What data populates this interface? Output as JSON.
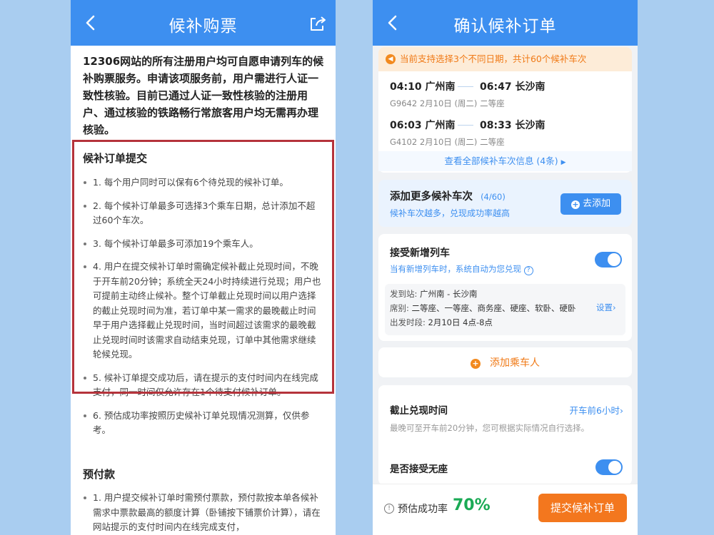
{
  "left": {
    "nav_title": "候补购票",
    "intro": "12306网站的所有注册用户均可自愿申请列车的候补购票服务。申请该项服务前，用户需进行人证一致性核验。目前已通过人证一致性核验的注册用户、通过核验的铁路畅行常旅客用户均无需再办理核验。",
    "section1_title": "候补订单提交",
    "rules": [
      "1. 每个用户同时可以保有6个待兑现的候补订单。",
      "2. 每个候补订单最多可选择3个乘车日期，总计添加不超过60个车次。",
      "3. 每个候补订单最多可添加19个乘车人。",
      "4. 用户在提交候补订单时需确定候补截止兑现时间，不晚于开车前20分钟；系统全天24小时持续进行兑现；用户也可提前主动终止候补。整个订单截止兑现时间以用户选择的截止兑现时间为准，若订单中某一需求的最晚截止时间早于用户选择截止兑现时间，当时间超过该需求的最晚截止兑现时间时该需求自动结束兑现，订单中其他需求继续轮候兑现。",
      "5. 候补订单提交成功后，请在提示的支付时间内在线完成支付，同一时间仅允许存在1个待支付候补订单。",
      "6. 预估成功率按照历史候补订单兑现情况测算，仅供参考。"
    ],
    "section2_title": "预付款",
    "prepay_rule": "1. 用户提交候补订单时需预付票款，预付款按本单各候补需求中票款最高的额度计算（卧铺按下铺票价计算），请在网站提示的支付时间内在线完成支付，"
  },
  "right": {
    "nav_title": "确认候补订单",
    "notice": "当前支持选择3个不同日期，共计60个候补车次",
    "trains": [
      {
        "depart": "04:10",
        "from": "广州南",
        "arrive": "06:47",
        "to": "长沙南",
        "code": "G9642",
        "date": "2月10日 (周二)",
        "seat": "二等座"
      },
      {
        "depart": "06:03",
        "from": "广州南",
        "arrive": "08:33",
        "to": "长沙南",
        "code": "G4102",
        "date": "2月10日 (周二)",
        "seat": "二等座"
      }
    ],
    "view_all": "查看全部候补车次信息 (4条)",
    "add_more_title": "添加更多候补车次",
    "add_more_count": "(4/60)",
    "add_more_sub": "候补车次越多，兑现成功率越高",
    "add_button": "去添加",
    "accept_new_title": "接受新增列车",
    "accept_new_sub": "当有新增列车时，系统自动为您兑现",
    "station_label": "发到站:",
    "station_value": "广州南 - 长沙南",
    "seat_label": "席别:",
    "seat_value": "二等座、一等座、商务座、硬座、软卧、硬卧",
    "settings_link": "设置",
    "time_label": "出发时段:",
    "time_value": "2月10日 4点-8点",
    "add_passenger": "添加乘车人",
    "deadline_title": "截止兑现时间",
    "deadline_value": "开车前6小时",
    "deadline_sub": "最晚可至开车前20分钟，您可根据实际情况自行选择。",
    "no_seat_title": "是否接受无座",
    "success_label": "预估成功率",
    "success_value": "70%",
    "submit_button": "提交候补订单"
  },
  "colors": {
    "nav_blue": "#3d8ff0",
    "orange": "#f07a17",
    "highlight_red": "#b5333b",
    "success_green": "#1aaa55"
  }
}
